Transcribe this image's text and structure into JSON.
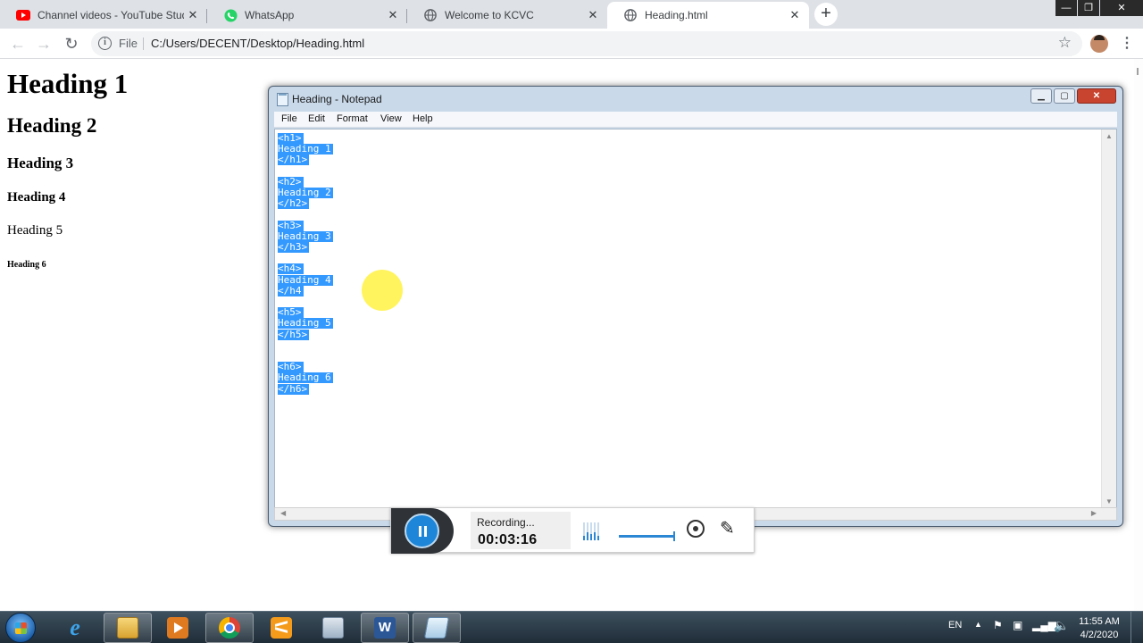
{
  "browser": {
    "tabs": [
      {
        "title": "Channel videos - YouTube Studio",
        "icon": "youtube-icon"
      },
      {
        "title": "WhatsApp",
        "icon": "whatsapp-icon"
      },
      {
        "title": "Welcome to KCVC",
        "icon": "globe-icon"
      },
      {
        "title": "Heading.html",
        "icon": "globe-icon",
        "active": true
      }
    ],
    "close_glyph": "✕",
    "new_tab_glyph": "+",
    "address": {
      "scheme_label": "File",
      "url": "C:/Users/DECENT/Desktop/Heading.html"
    }
  },
  "page": {
    "headings": [
      "Heading 1",
      "Heading 2",
      "Heading 3",
      "Heading 4",
      "Heading 5",
      "Heading 6"
    ]
  },
  "notepad": {
    "title": "Heading - Notepad",
    "menu": [
      "File",
      "Edit",
      "Format",
      "View",
      "Help"
    ],
    "lines": [
      "<h1>",
      "Heading 1",
      "</h1>",
      "",
      "<h2>",
      "Heading 2",
      "</h2>",
      "",
      "<h3>",
      "Heading 3",
      "</h3>",
      "",
      "<h4>",
      "Heading 4",
      "</h4",
      "",
      "<h5>",
      "Heading 5",
      "</h5>",
      "",
      "",
      "<h6>",
      "Heading 6",
      "</h6>"
    ],
    "selection_color": "#3399ff"
  },
  "recorder": {
    "status": "Recording...",
    "time": "00:03:16",
    "accent_color": "#1e86d8"
  },
  "taskbar": {
    "language": "EN",
    "time": "11:55 AM",
    "date": "4/2/2020",
    "apps": [
      "explorer-icon",
      "internet-explorer-icon",
      "media-player-icon",
      "chrome-icon",
      "sublime-text-icon",
      "calculator-icon",
      "word-icon",
      "notepad-icon"
    ]
  }
}
